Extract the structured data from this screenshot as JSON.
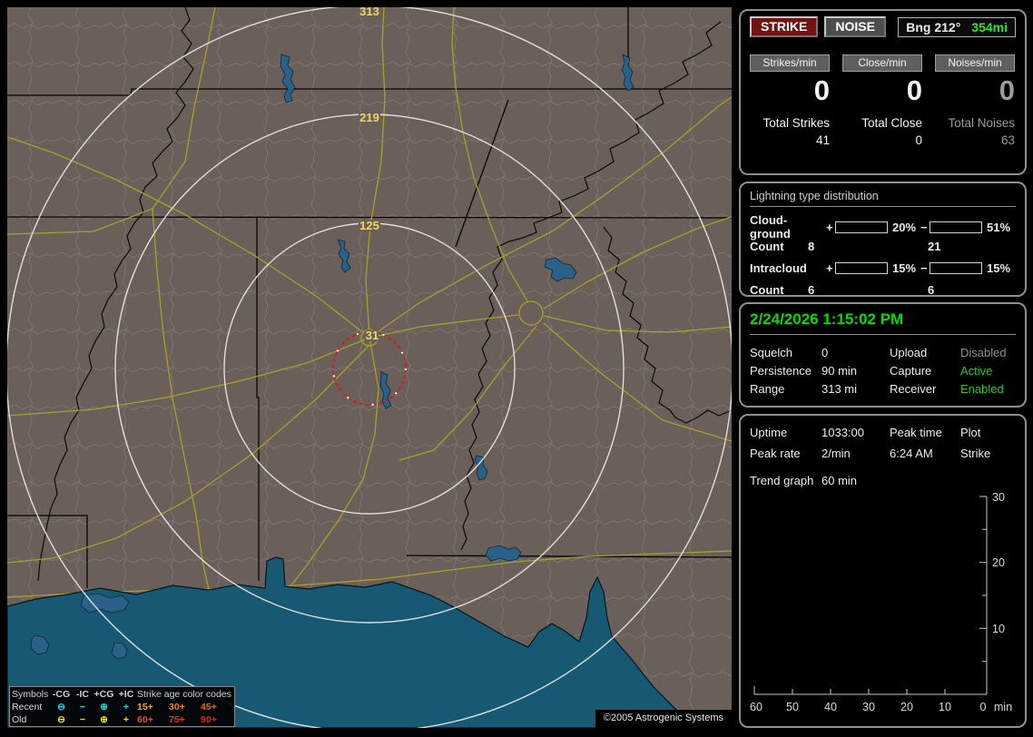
{
  "window": {
    "copyright": "©2005 Astrogenic Systems"
  },
  "map": {
    "colors": {
      "land": "#6b5f5a",
      "water": "#175873",
      "lake": "#2b6089",
      "road": "#a89f2d",
      "county": "#8a8580",
      "state": "#050505",
      "river": "#0a0a0a",
      "ring": "#dedede",
      "alarm_ring": "#dd1515",
      "ring_label": "#ead964"
    },
    "rings": {
      "labels": [
        "313",
        "219",
        "125",
        "31"
      ]
    },
    "legend": {
      "symbols_header": "Symbols",
      "type_headers": [
        "-CG",
        "-IC",
        "+CG",
        "+IC"
      ],
      "age_header": "Strike age color codes",
      "rows": [
        {
          "label": "Recent",
          "symbol_color": "#00dcdc",
          "symbols": [
            "⊖",
            "−",
            "⊕",
            "+"
          ],
          "ages": [
            {
              "text": "15+",
              "color": "#f5a400"
            },
            {
              "text": "30+",
              "color": "#f08400"
            },
            {
              "text": "45+",
              "color": "#ec6400"
            }
          ]
        },
        {
          "label": "Old",
          "symbol_color": "#e2df1f",
          "symbols": [
            "⊖",
            "−",
            "⊕",
            "+"
          ],
          "ages": [
            {
              "text": "60+",
              "color": "#e85000"
            },
            {
              "text": "75+",
              "color": "#e23808"
            },
            {
              "text": "90+",
              "color": "#de2008"
            }
          ]
        }
      ]
    }
  },
  "panels": {
    "stats": {
      "strike_button": "STRIKE",
      "strike_button_bg": "#701414",
      "noise_button": "NOISE",
      "noise_button_bg": "#4d4d4d",
      "bearing_label": "Bng 212°",
      "bearing_range": "354mi",
      "bearing_range_color": "#2ee22e",
      "columns": [
        {
          "header": "Strikes/min",
          "rate": "0",
          "total_label": "Total Strikes",
          "total": "41",
          "color": "#f4f4f4"
        },
        {
          "header": "Close/min",
          "rate": "0",
          "total_label": "Total Close",
          "total": "0",
          "color": "#f4f4f4"
        },
        {
          "header": "Noises/min",
          "rate": "0",
          "total_label": "Total Noises",
          "total": "63",
          "color": "#9c9c9c"
        }
      ]
    },
    "distribution": {
      "title": "Lightning type distribution",
      "rows": [
        {
          "label": "Cloud-ground",
          "plus": "+",
          "minus": "−",
          "pos_pct": "20%",
          "pos_color": "#f01010",
          "neg_pct": "51%",
          "neg_color": "#8fc8f0",
          "count_label": "Count",
          "pos_count": "8",
          "neg_count": "21"
        },
        {
          "label": "Intracloud",
          "plus": "+",
          "minus": "−",
          "pos_pct": "15%",
          "pos_color": "#e06cc8",
          "neg_pct": "15%",
          "neg_color": "#28dc28",
          "count_label": "Count",
          "pos_count": "6",
          "neg_count": "6"
        }
      ]
    },
    "status": {
      "datetime": "2/24/2026 1:15:02 PM",
      "datetime_color": "#00dd00",
      "rows": [
        {
          "l1": "Squelch",
          "v1": "0",
          "l2": "Upload",
          "v2": "Disabled",
          "v2_color": "#8f8f8f"
        },
        {
          "l1": "Persistence",
          "v1": "90 min",
          "l2": "Capture",
          "v2": "Active",
          "v2_color": "#28c828"
        },
        {
          "l1": "Range",
          "v1": "313 mi",
          "l2": "Receiver",
          "v2": "Enabled",
          "v2_color": "#28c828"
        }
      ]
    },
    "activity": {
      "rows": [
        {
          "l1": "Uptime",
          "v1": "1033:00",
          "l2": "Peak time",
          "v2": "Plot"
        },
        {
          "l1": "Peak rate",
          "v1": "2/min",
          "l2": "6:24 AM",
          "v2": "Strike"
        }
      ],
      "trend_label": "Trend graph",
      "trend_window": "60 min",
      "chart_data": {
        "type": "line",
        "x_ticks": [
          "60",
          "50",
          "40",
          "30",
          "20",
          "10",
          "0"
        ],
        "x_unit": "min",
        "y_ticks": [
          "30",
          "20",
          "10"
        ],
        "ylim": [
          0,
          30
        ],
        "xlim": [
          60,
          0
        ],
        "series": []
      }
    }
  }
}
